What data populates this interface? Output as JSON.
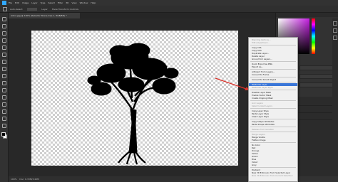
{
  "menubar": {
    "items": [
      "File",
      "Edit",
      "Image",
      "Layer",
      "Type",
      "Select",
      "Filter",
      "3D",
      "View",
      "Window",
      "Help"
    ]
  },
  "options": {
    "auto_select": "Auto-Select:",
    "layer": "Layer",
    "transform": "Show Transform Controls"
  },
  "document": {
    "tab_title": "Arbre.jpg @ 100% (Rebellor Stone-tree 1, RGB/8#) *"
  },
  "status": {
    "zoom": "100%",
    "doc_info": "Doc: 6.33M/3.40M"
  },
  "colors": {
    "accent": "#3a76d8",
    "foreground": "#000000",
    "background": "#ffffff",
    "picker_hue": "#c51fe2",
    "arrow": "#d9322b"
  },
  "context_menu": {
    "items": [
      {
        "label": "Blending Options...",
        "state": "disabled"
      },
      {
        "label": "Edit Adjustment...",
        "state": "disabled"
      },
      {
        "sep": true
      },
      {
        "label": "Copy CSS",
        "state": "enabled"
      },
      {
        "label": "Copy SVG",
        "state": "enabled"
      },
      {
        "label": "Duplicate Layer...",
        "state": "enabled"
      },
      {
        "label": "Delete Layer",
        "state": "enabled"
      },
      {
        "label": "Group from Layers...",
        "state": "enabled"
      },
      {
        "sep": true
      },
      {
        "label": "Quick Export as PNG",
        "state": "enabled"
      },
      {
        "label": "Export As...",
        "state": "enabled"
      },
      {
        "sep": true
      },
      {
        "label": "Artboard from Layers...",
        "state": "enabled"
      },
      {
        "label": "Convert to Frame",
        "state": "enabled"
      },
      {
        "sep": true
      },
      {
        "label": "Convert to Smart Object",
        "state": "enabled"
      },
      {
        "sep": true
      },
      {
        "label": "Rasterize Layer",
        "state": "highlighted"
      },
      {
        "label": "Rasterize Layer Style",
        "state": "disabled"
      },
      {
        "sep": true
      },
      {
        "label": "Disable Layer Mask",
        "state": "enabled"
      },
      {
        "label": "Enable Vector Mask",
        "state": "enabled"
      },
      {
        "label": "Create Clipping Mask",
        "state": "enabled"
      },
      {
        "sep": true
      },
      {
        "label": "Link Layers",
        "state": "disabled"
      },
      {
        "label": "Select Linked Layers",
        "state": "disabled"
      },
      {
        "sep": true
      },
      {
        "label": "Copy Layer Style",
        "state": "enabled"
      },
      {
        "label": "Paste Layer Style",
        "state": "enabled"
      },
      {
        "label": "Clear Layer Style",
        "state": "enabled"
      },
      {
        "sep": true
      },
      {
        "label": "Copy Shape Attributes",
        "state": "enabled"
      },
      {
        "label": "Paste Shape Attributes",
        "state": "enabled"
      },
      {
        "sep": true
      },
      {
        "label": "Release from Isolation",
        "state": "disabled"
      },
      {
        "sep": true
      },
      {
        "label": "Merge Layers",
        "state": "disabled"
      },
      {
        "label": "Merge Visible",
        "state": "enabled"
      },
      {
        "label": "Flatten Image",
        "state": "enabled"
      },
      {
        "sep": true
      },
      {
        "label": "No Color",
        "state": "enabled"
      },
      {
        "label": "Red",
        "state": "enabled"
      },
      {
        "label": "Orange",
        "state": "enabled"
      },
      {
        "label": "Yellow",
        "state": "enabled"
      },
      {
        "label": "Green",
        "state": "enabled"
      },
      {
        "label": "Blue",
        "state": "enabled"
      },
      {
        "label": "Violet",
        "state": "enabled"
      },
      {
        "label": "Gray",
        "state": "enabled"
      },
      {
        "sep": true
      },
      {
        "label": "Postcard",
        "state": "enabled"
      },
      {
        "label": "New 3D Extrusion from Selected Layer",
        "state": "enabled"
      },
      {
        "label": "New 3D Extrusion from Current Selection",
        "state": "disabled"
      }
    ]
  }
}
